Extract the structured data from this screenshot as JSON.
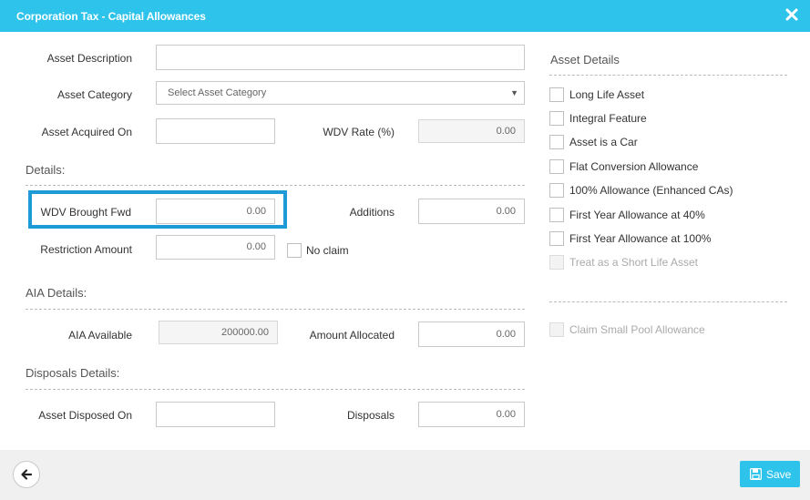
{
  "window": {
    "title": "Corporation Tax - Capital Allowances"
  },
  "form": {
    "asset_description_label": "Asset Description",
    "asset_description_value": "",
    "asset_category_label": "Asset Category",
    "asset_category_placeholder": "Select Asset Category",
    "asset_acquired_label": "Asset Acquired On",
    "asset_acquired_value": "",
    "wdv_rate_label": "WDV Rate (%)",
    "wdv_rate_value": "0.00"
  },
  "details": {
    "heading": "Details:",
    "wdv_brought_fwd_label": "WDV Brought Fwd",
    "wdv_brought_fwd_value": "0.00",
    "additions_label": "Additions",
    "additions_value": "0.00",
    "restriction_label": "Restriction Amount",
    "restriction_value": "0.00",
    "no_claim_label": "No claim"
  },
  "aia": {
    "heading": "AIA Details:",
    "available_label": "AIA Available",
    "available_value": "200000.00",
    "allocated_label": "Amount Allocated",
    "allocated_value": "0.00"
  },
  "disposals": {
    "heading": "Disposals Details:",
    "disposed_on_label": "Asset Disposed On",
    "disposed_on_value": "",
    "disposals_label": "Disposals",
    "disposals_value": "0.00"
  },
  "asset_details": {
    "heading": "Asset Details",
    "options": [
      "Long Life Asset",
      "Integral Feature",
      "Asset is a Car",
      "Flat Conversion Allowance",
      "100% Allowance (Enhanced CAs)",
      "First Year Allowance at 40%",
      "First Year Allowance at 100%",
      "Treat as a Short Life Asset"
    ],
    "small_pool_label": "Claim Small Pool Allowance"
  },
  "footer": {
    "save_label": "Save"
  },
  "colors": {
    "accent": "#2ec3ea",
    "highlight": "#1e9ad6"
  }
}
